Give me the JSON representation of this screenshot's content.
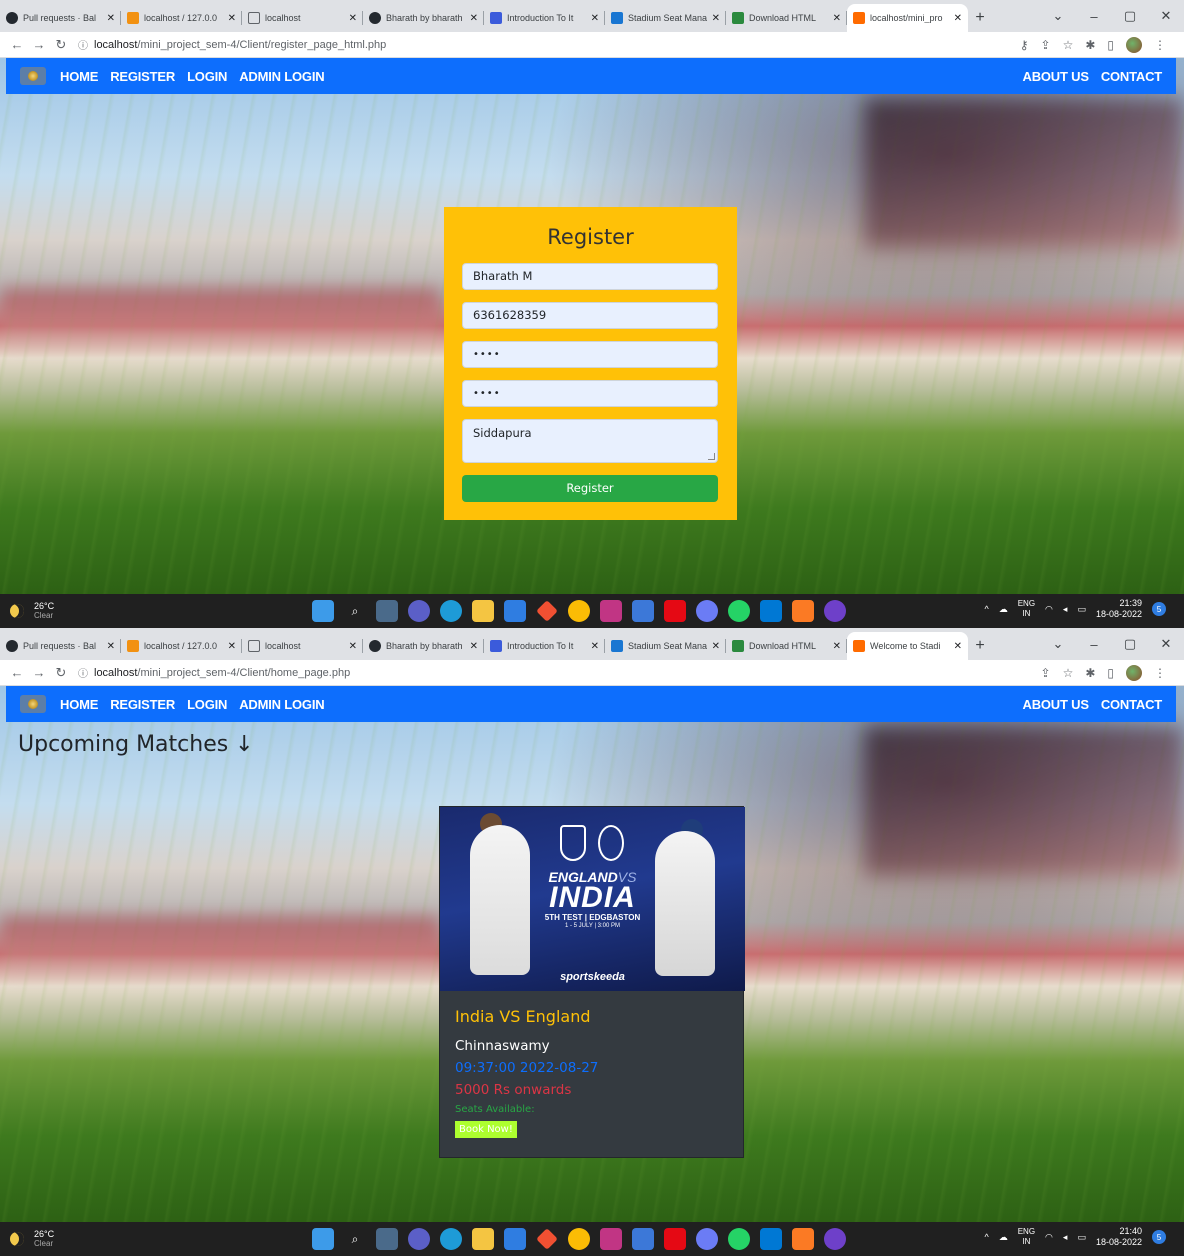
{
  "screens": [
    {
      "tabs": [
        {
          "title": "Pull requests · Bal",
          "icon_color": "#24292f"
        },
        {
          "title": "localhost / 127.0.0",
          "icon_color": "#f29111"
        },
        {
          "title": "localhost",
          "icon_color": "#5f6368"
        },
        {
          "title": "Bharath by bharath",
          "icon_color": "#24292f"
        },
        {
          "title": "Introduction To It",
          "icon_color": "#3b5bdb"
        },
        {
          "title": "Stadium Seat Mana",
          "icon_color": "#1976d2"
        },
        {
          "title": "Download HTML",
          "icon_color": "#2b8a3e"
        },
        {
          "title": "localhost/mini_pro",
          "icon_color": "#ff6b00",
          "active": true
        }
      ],
      "url_host": "localhost",
      "url_path": "/mini_project_sem-4/Client/register_page_html.php",
      "taskbar": {
        "temp": "26°C",
        "condition": "Clear",
        "time": "21:39",
        "date": "18-08-2022"
      }
    },
    {
      "tabs": [
        {
          "title": "Pull requests · Bal",
          "icon_color": "#24292f"
        },
        {
          "title": "localhost / 127.0.0",
          "icon_color": "#f29111"
        },
        {
          "title": "localhost",
          "icon_color": "#5f6368"
        },
        {
          "title": "Bharath by bharath",
          "icon_color": "#24292f"
        },
        {
          "title": "Introduction To It",
          "icon_color": "#3b5bdb"
        },
        {
          "title": "Stadium Seat Mana",
          "icon_color": "#1976d2"
        },
        {
          "title": "Download HTML",
          "icon_color": "#2b8a3e"
        },
        {
          "title": "Welcome to Stadi",
          "icon_color": "#ff6b00",
          "active": true
        }
      ],
      "url_host": "localhost",
      "url_path": "/mini_project_sem-4/Client/home_page.php",
      "taskbar": {
        "temp": "26°C",
        "condition": "Clear",
        "time": "21:40",
        "date": "18-08-2022"
      }
    }
  ],
  "nav": {
    "left": [
      "HOME",
      "REGISTER",
      "LOGIN",
      "ADMIN LOGIN"
    ],
    "right": [
      "ABOUT US",
      "CONTACT"
    ]
  },
  "register": {
    "title": "Register",
    "name_value": "Bharath M",
    "phone_value": "6361628359",
    "password_value": "••••",
    "confirm_value": "••••",
    "address_value": "Siddapura",
    "button_label": "Register"
  },
  "home": {
    "heading": "Upcoming Matches ↓",
    "match": {
      "poster_line1": "ENGLAND",
      "poster_vs": "VS",
      "poster_line2": "INDIA",
      "poster_sub": "5TH TEST | EDGBASTON",
      "poster_date": "1 - 5 JULY | 3:00 PM",
      "poster_brand": "sportskeeda",
      "title": "India VS England",
      "venue": "Chinnaswamy",
      "datetime": "09:37:00 2022-08-27",
      "price": "5000 Rs onwards",
      "seats": "Seats Available:",
      "button_label": "Book Now!"
    }
  },
  "window_controls": [
    "⌄",
    "–",
    "▢",
    "✕"
  ],
  "tray": {
    "lang1": "ENG",
    "lang2": "IN"
  }
}
